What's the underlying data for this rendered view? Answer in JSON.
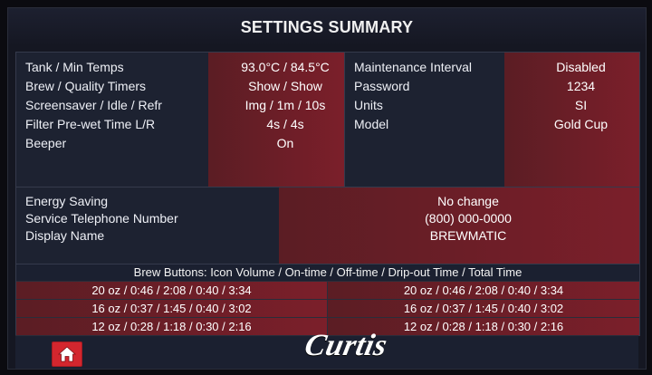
{
  "title": "SETTINGS SUMMARY",
  "left_settings": [
    {
      "label": "Tank / Min Temps",
      "value": "93.0°C / 84.5°C"
    },
    {
      "label": "Brew / Quality Timers",
      "value": "Show / Show"
    },
    {
      "label": "Screensaver / Idle / Refr",
      "value": "Img / 1m / 10s"
    },
    {
      "label": "Filter Pre-wet Time L/R",
      "value": "4s / 4s"
    },
    {
      "label": "Beeper",
      "value": "On"
    }
  ],
  "right_settings": [
    {
      "label": "Maintenance Interval",
      "value": "Disabled"
    },
    {
      "label": "Password",
      "value": "1234"
    },
    {
      "label": "Units",
      "value": "SI"
    },
    {
      "label": "Model",
      "value": "Gold Cup"
    }
  ],
  "middle_settings": [
    {
      "label": "Energy Saving",
      "value": "No change"
    },
    {
      "label": "Service Telephone Number",
      "value": "(800) 000-0000"
    },
    {
      "label": "Display Name",
      "value": "BREWMATIC"
    }
  ],
  "brew_buttons": {
    "header": "Brew Buttons: Icon Volume / On-time / Off-time / Drip-out Time / Total Time",
    "left": [
      "20 oz / 0:46 / 2:08 / 0:40 / 3:34",
      "16 oz / 0:37 / 1:45 / 0:40 / 3:02",
      "12 oz / 0:28 / 1:18 / 0:30 / 2:16"
    ],
    "right": [
      "20 oz / 0:46 / 2:08 / 0:40 / 3:34",
      "16 oz / 0:37 / 1:45 / 0:40 / 3:02",
      "12 oz / 0:28 / 1:18 / 0:30 / 2:16"
    ]
  },
  "footer": {
    "brand": "Curtis"
  },
  "icons": {
    "home": "home-icon"
  },
  "colors": {
    "panel_bg": "#1d2231",
    "value_red": "#7b1f2a",
    "home_red": "#d3262e"
  }
}
